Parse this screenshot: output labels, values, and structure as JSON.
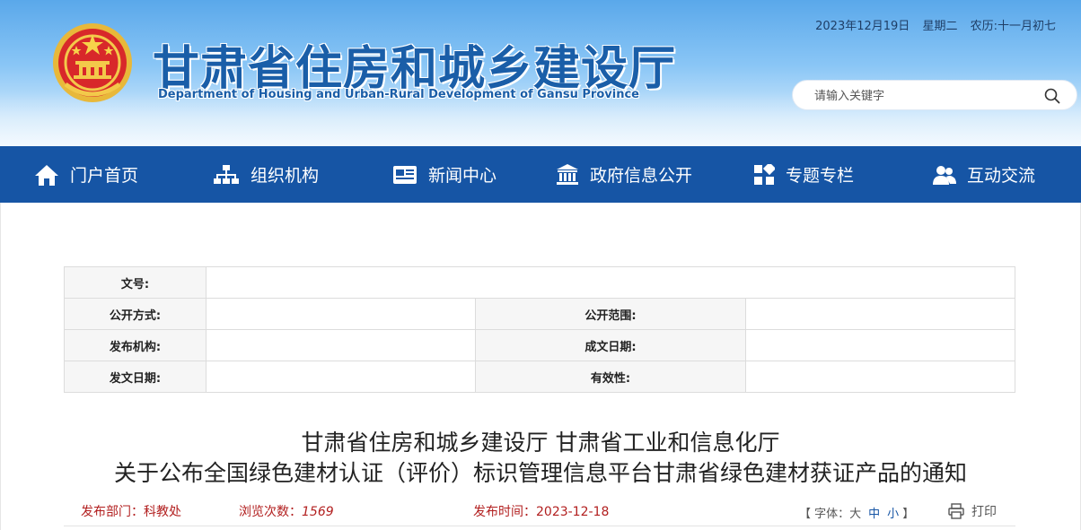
{
  "header": {
    "site_title": "甘肃省住房和城乡建设厅",
    "site_subtitle": "Department of Housing and Urban-Rural Development of Gansu Province",
    "date": "2023年12月19日",
    "weekday": "星期二",
    "lunar": "农历:十一月初七",
    "search_placeholder": "请输入关键字",
    "emblem_icon": "national-emblem-icon"
  },
  "nav": {
    "items": [
      {
        "label": "门户首页",
        "icon": "home-icon"
      },
      {
        "label": "组织机构",
        "icon": "org-chart-icon"
      },
      {
        "label": "新闻中心",
        "icon": "newspaper-icon"
      },
      {
        "label": "政府信息公开",
        "icon": "government-building-icon"
      },
      {
        "label": "专题专栏",
        "icon": "grid-icon"
      },
      {
        "label": "互动交流",
        "icon": "users-icon"
      }
    ]
  },
  "meta_table": {
    "doc_no_label": "文号:",
    "doc_no_value": "",
    "disclosure_mode_label": "公开方式:",
    "disclosure_mode_value": "",
    "disclosure_scope_label": "公开范围:",
    "disclosure_scope_value": "",
    "issuer_label": "发布机构:",
    "issuer_value": "",
    "created_date_label": "成文日期:",
    "created_date_value": "",
    "issue_date_label": "发文日期:",
    "issue_date_value": "",
    "validity_label": "有效性:",
    "validity_value": ""
  },
  "article": {
    "title_line1": "甘肃省住房和城乡建设厅 甘肃省工业和信息化厅",
    "title_line2": "关于公布全国绿色建材认证（评价）标识管理信息平台甘肃省绿色建材获证产品的通知",
    "department_label": "发布部门：",
    "department_value": "科教处",
    "views_label": "浏览次数：",
    "views_value": "1569",
    "publish_time_label": "发布时间：",
    "publish_time_value": "2023-12-18",
    "font_size_prefix": "【 字体：",
    "font_large": "大",
    "font_medium": "中",
    "font_small": "小",
    "font_size_suffix": "】",
    "print_label": "打印"
  },
  "colors": {
    "nav_bg": "#1655a5",
    "title_blue": "#1a5ea8",
    "info_red": "#b21f1f"
  }
}
